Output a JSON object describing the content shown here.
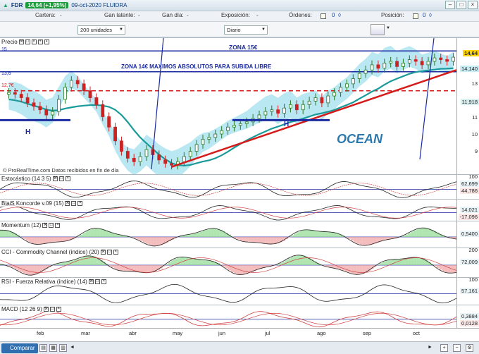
{
  "titlebar": {
    "symbol": "FDR",
    "change": "14,64 (+1,95%)",
    "date": "09-oct-2020 FLUIDRA"
  },
  "posbar": {
    "cartera": "Cartera:",
    "cartera_val": "-",
    "ganlat": "Gan latente:",
    "ganlat_val": "-",
    "gandia": "Gan día:",
    "gandia_val": "-",
    "expo": "Exposición:",
    "expo_val": "-",
    "ordenes": "Órdenes:",
    "ordenes_val": "0",
    "posicion": "Posición:",
    "posicion_val": "0"
  },
  "toolbar": {
    "units": "200 unidades",
    "period": "Diario"
  },
  "price_panel": {
    "title": "Precio",
    "source": "© ProRealTime.com  Datos recibidos en fin de día",
    "annotations": {
      "zona15": "ZONA 15€",
      "zona14": "ZONA 14€ MAXIMOS ABSOLUTOS PARA SUBIDA LIBRE",
      "h_left": "H",
      "h_right": "H",
      "ocean": "OCEAN",
      "lbl_15": "15",
      "lbl_136": "13,6",
      "lbl_127": "12,7€"
    },
    "scale": [
      "13",
      "12",
      "11",
      "10",
      "9"
    ],
    "tags": {
      "last": "14,64",
      "t2": "14,140",
      "t3": "11,918"
    }
  },
  "indicators": [
    {
      "title": "Estocástico (14 3 5)",
      "top": "100",
      "v1": "62,699",
      "v2": "44,786"
    },
    {
      "title": "BlaiS Koncorde v.09 (15)",
      "v1": "14,021",
      "v2": "-17,096"
    },
    {
      "title": "Momentum (12)",
      "v1": "0,5400"
    },
    {
      "title": "CCI - Commodity Channel (índice) (20)",
      "top": "200",
      "v1": "72,009"
    },
    {
      "title": "RSI - Fuerza Relativa (índice) (14)",
      "top": "100",
      "v1": "57,161"
    },
    {
      "title": "MACD (12 26 9)",
      "v1": "0,3884",
      "v2": "0,0128"
    }
  ],
  "xaxis": [
    "feb",
    "mar",
    "abr",
    "may",
    "jun",
    "jul",
    "ago",
    "sep",
    "oct"
  ],
  "bottom": {
    "compare": "Comparar"
  },
  "colors": {
    "up": "#2a7a2a",
    "down": "#c22",
    "cloud": "#7fd3e8",
    "cloud2": "#a8e8a0",
    "support": "#d61a1a",
    "zone": "#1a2aa0",
    "ma": "#1a9a9a"
  },
  "chart_data": {
    "type": "candlestick",
    "ylim": [
      8,
      15.5
    ],
    "x_labels": [
      "feb",
      "mar",
      "abr",
      "may",
      "jun",
      "jul",
      "ago",
      "sep",
      "oct"
    ],
    "close": [
      12.6,
      12.5,
      12.3,
      12.0,
      11.8,
      11.6,
      11.3,
      11.5,
      12.2,
      12.9,
      13.3,
      13.1,
      12.7,
      12.3,
      11.9,
      11.2,
      10.6,
      9.8,
      9.2,
      8.8,
      8.6,
      8.9,
      9.3,
      9.0,
      8.7,
      8.5,
      8.4,
      8.6,
      8.9,
      9.2,
      9.6,
      9.9,
      10.0,
      10.2,
      10.4,
      10.6,
      10.7,
      10.8,
      10.9,
      11.1,
      11.3,
      11.5,
      11.6,
      11.4,
      11.7,
      11.9,
      11.6,
      11.9,
      12.1,
      12.3,
      12.0,
      12.4,
      12.6,
      12.9,
      13.1,
      13.4,
      13.7,
      13.9,
      14.2,
      14.0,
      14.3,
      14.4,
      14.1,
      14.3,
      14.5,
      14.4,
      14.2,
      14.4,
      14.6,
      14.5,
      14.4,
      14.64
    ],
    "series_lines": [
      {
        "name": "zona 15",
        "value": 15.0
      },
      {
        "name": "zona 14",
        "value": 13.8
      },
      {
        "name": "12,7",
        "value": 12.7
      }
    ]
  }
}
